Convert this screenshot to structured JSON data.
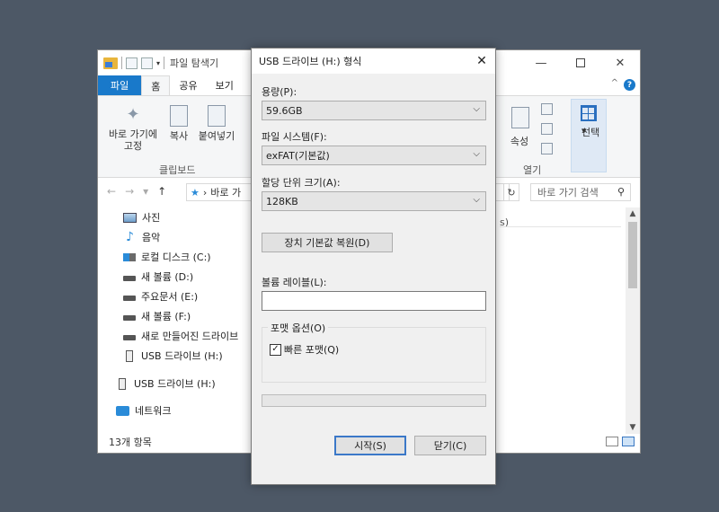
{
  "explorer": {
    "title": "파일 탐색기",
    "tabs": [
      {
        "label": "파일"
      },
      {
        "label": "홈"
      },
      {
        "label": "공유"
      },
      {
        "label": "보기"
      }
    ],
    "ribbon": {
      "pin_label_1": "바로 가기에",
      "pin_label_2": "고정",
      "copy_label": "복사",
      "paste_label": "붙여넣기",
      "clipboard_group": "클립보드",
      "properties_label": "속성",
      "open_group": "열기",
      "select_label": "선택",
      "select_arrow": "▾"
    },
    "address": {
      "path": "바로 가",
      "search_placeholder": "바로 가기 검색"
    },
    "nav_items": [
      {
        "label": "사진"
      },
      {
        "label": "음악"
      },
      {
        "label": "로컬 디스크 (C:)"
      },
      {
        "label": "새 볼륨 (D:)"
      },
      {
        "label": "주요문서 (E:)"
      },
      {
        "label": "새 볼륨 (F:)"
      },
      {
        "label": "새로 만들어진 드라이브"
      },
      {
        "label": "USB 드라이브 (H:)"
      },
      {
        "label": "USB 드라이브 (H:)"
      },
      {
        "label": "네트워크"
      }
    ],
    "content_fragment": "s)",
    "status": "13개 항목"
  },
  "dialog": {
    "title": "USB 드라이브 (H:) 형식",
    "capacity_label": "용량(P):",
    "capacity_value": "59.6GB",
    "filesystem_label": "파일 시스템(F):",
    "filesystem_value": "exFAT(기본값)",
    "allocation_label": "할당 단위 크기(A):",
    "allocation_value": "128KB",
    "restore_defaults": "장치 기본값 복원(D)",
    "volume_label_label": "볼륨 레이블(L):",
    "volume_label_value": "",
    "format_options_label": "포맷 옵션(O)",
    "quick_format_label": "빠른 포맷(Q)",
    "quick_format_checked": true,
    "progress": 0,
    "start_button": "시작(S)",
    "close_button": "닫기(C)"
  }
}
